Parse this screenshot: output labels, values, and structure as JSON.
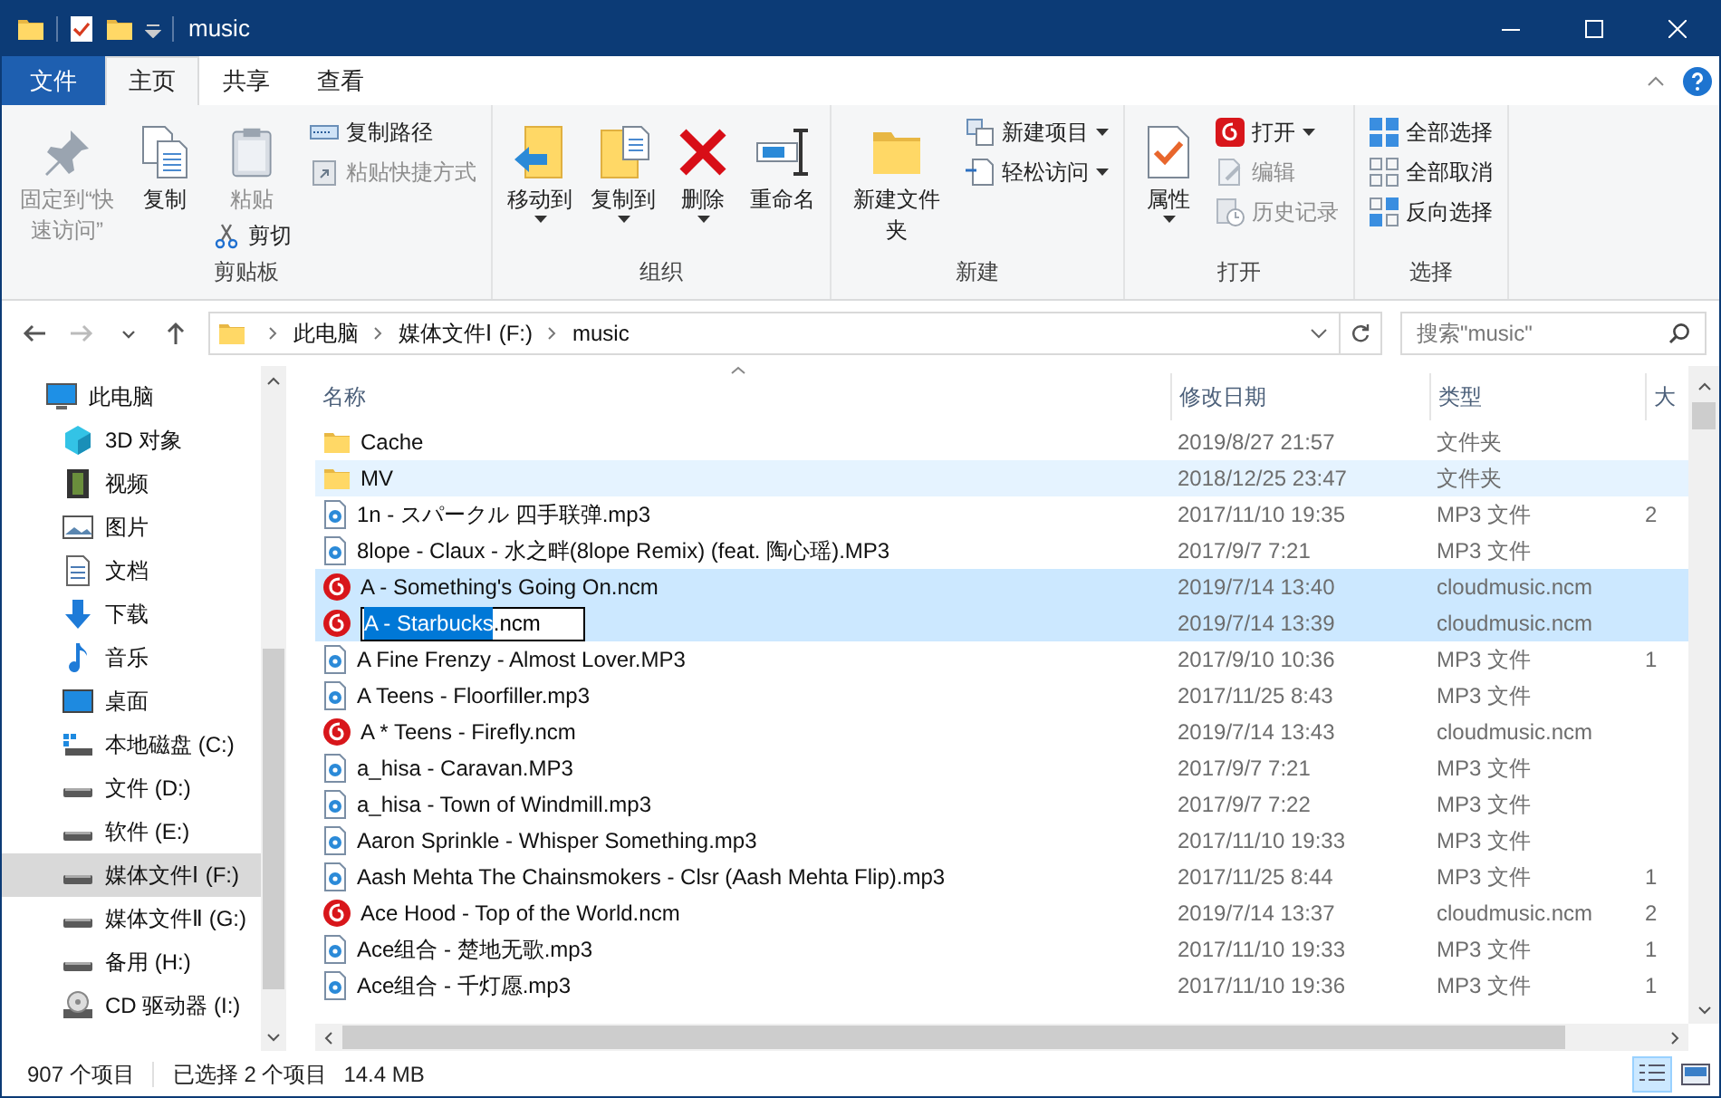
{
  "window": {
    "title": "music"
  },
  "ribbon_tabs": [
    {
      "label": "文件",
      "kind": "file",
      "selected": false
    },
    {
      "label": "主页",
      "kind": "tab",
      "selected": true
    },
    {
      "label": "共享",
      "kind": "tab",
      "selected": false
    },
    {
      "label": "查看",
      "kind": "tab",
      "selected": false
    }
  ],
  "ribbon_groups": [
    {
      "label": "剪贴板",
      "columns": [
        [
          {
            "label": "固定到“快速访问”",
            "kind": "large",
            "disabled": true,
            "dropdown": false
          }
        ],
        [
          {
            "label": "复制",
            "kind": "large",
            "disabled": false,
            "dropdown": false
          }
        ],
        [
          {
            "label": "粘贴",
            "kind": "medium",
            "disabled": true,
            "dropdown": false
          },
          {
            "label": "剪切",
            "kind": "small",
            "disabled": false,
            "dropdown": false
          }
        ],
        [
          {
            "label": "复制路径",
            "kind": "small",
            "disabled": false,
            "dropdown": false
          },
          {
            "label": "粘贴快捷方式",
            "kind": "small",
            "disabled": true,
            "dropdown": false
          }
        ]
      ]
    },
    {
      "label": "组织",
      "columns": [
        [
          {
            "label": "移动到",
            "kind": "large",
            "disabled": false,
            "dropdown": true
          }
        ],
        [
          {
            "label": "复制到",
            "kind": "large",
            "disabled": false,
            "dropdown": true
          }
        ],
        [
          {
            "label": "删除",
            "kind": "large",
            "disabled": false,
            "dropdown": true
          }
        ],
        [
          {
            "label": "重命名",
            "kind": "large",
            "disabled": false,
            "dropdown": false
          }
        ]
      ]
    },
    {
      "label": "新建",
      "columns": [
        [
          {
            "label": "新建文件夹",
            "kind": "large",
            "disabled": false,
            "dropdown": false
          }
        ],
        [
          {
            "label": "新建项目",
            "kind": "small",
            "disabled": false,
            "dropdown": true
          },
          {
            "label": "轻松访问",
            "kind": "small",
            "disabled": false,
            "dropdown": true
          }
        ]
      ]
    },
    {
      "label": "打开",
      "columns": [
        [
          {
            "label": "属性",
            "kind": "large",
            "disabled": false,
            "dropdown": true
          }
        ],
        [
          {
            "label": "打开",
            "kind": "small",
            "disabled": false,
            "dropdown": true
          },
          {
            "label": "编辑",
            "kind": "small",
            "disabled": true,
            "dropdown": false
          },
          {
            "label": "历史记录",
            "kind": "small",
            "disabled": true,
            "dropdown": false
          }
        ]
      ]
    },
    {
      "label": "选择",
      "columns": [
        [
          {
            "label": "全部选择",
            "kind": "small",
            "disabled": false,
            "dropdown": false
          },
          {
            "label": "全部取消",
            "kind": "small",
            "disabled": false,
            "dropdown": false
          },
          {
            "label": "反向选择",
            "kind": "small",
            "disabled": false,
            "dropdown": false
          }
        ]
      ]
    }
  ],
  "nav_buttons": [
    {
      "kind": "back",
      "disabled": false
    },
    {
      "kind": "forward",
      "disabled": true
    },
    {
      "kind": "recent",
      "disabled": false
    },
    {
      "kind": "up",
      "disabled": false
    }
  ],
  "breadcrumb": [
    "此电脑",
    "媒体文件Ⅰ (F:)",
    "music"
  ],
  "search": {
    "placeholder": "搜索\"music\""
  },
  "nav_pane": {
    "items": [
      {
        "label": "此电脑",
        "kind": "pc",
        "selected": false,
        "children": [
          {
            "label": "3D 对象",
            "kind": "cube",
            "selected": false
          },
          {
            "label": "视频",
            "kind": "film",
            "selected": false
          },
          {
            "label": "图片",
            "kind": "picture",
            "selected": false
          },
          {
            "label": "文档",
            "kind": "doc",
            "selected": false
          },
          {
            "label": "下载",
            "kind": "download",
            "selected": false
          },
          {
            "label": "音乐",
            "kind": "music",
            "selected": false
          },
          {
            "label": "桌面",
            "kind": "desktop",
            "selected": false
          },
          {
            "label": "本地磁盘 (C:)",
            "kind": "system-drive",
            "selected": false
          },
          {
            "label": "文件 (D:)",
            "kind": "drive",
            "selected": false
          },
          {
            "label": "软件 (E:)",
            "kind": "drive",
            "selected": false
          },
          {
            "label": "媒体文件Ⅰ (F:)",
            "kind": "drive",
            "selected": true
          },
          {
            "label": "媒体文件Ⅱ (G:)",
            "kind": "drive",
            "selected": false
          },
          {
            "label": "备用 (H:)",
            "kind": "drive",
            "selected": false
          },
          {
            "label": "CD 驱动器 (I:)",
            "kind": "cd",
            "selected": false
          }
        ]
      }
    ]
  },
  "file_list": {
    "columns": [
      "名称",
      "修改日期",
      "类型",
      "大"
    ],
    "rows": [
      {
        "name": "Cache",
        "kind": "folder",
        "date": "2019/8/27 21:57",
        "type": "文件夹",
        "selected": false,
        "hovered": false,
        "editing": false
      },
      {
        "name": "MV",
        "kind": "folder",
        "date": "2018/12/25 23:47",
        "type": "文件夹",
        "selected": false,
        "hovered": true,
        "editing": false
      },
      {
        "name": "1n - スパークル 四手联弹.mp3",
        "kind": "mp3",
        "date": "2017/11/10 19:35",
        "type": "MP3 文件",
        "column_4": "2",
        "selected": false,
        "hovered": false,
        "editing": false
      },
      {
        "name": "8lope - Claux - 水之畔(8lope Remix) (feat. 陶心瑶).MP3",
        "kind": "mp3",
        "date": "2017/9/7 7:21",
        "type": "MP3 文件",
        "selected": false,
        "hovered": false,
        "editing": false
      },
      {
        "name": "A - Something's Going On.ncm",
        "kind": "ncm",
        "date": "2019/7/14 13:40",
        "type": "cloudmusic.ncm",
        "selected": true,
        "hovered": false,
        "editing": false
      },
      {
        "name_selected": "A - Starbucks",
        "name_rest": ".ncm",
        "kind": "ncm",
        "date": "2019/7/14 13:39",
        "type": "cloudmusic.ncm",
        "selected": true,
        "hovered": false,
        "editing": true
      },
      {
        "name": "A Fine Frenzy - Almost Lover.MP3",
        "kind": "mp3",
        "date": "2017/9/10 10:36",
        "type": "MP3 文件",
        "column_4": "1",
        "selected": false,
        "hovered": false,
        "editing": false
      },
      {
        "name": "A Teens - Floorfiller.mp3",
        "kind": "mp3",
        "date": "2017/11/25 8:43",
        "type": "MP3 文件",
        "selected": false,
        "hovered": false,
        "editing": false
      },
      {
        "name": "A * Teens - Firefly.ncm",
        "kind": "ncm",
        "date": "2019/7/14 13:43",
        "type": "cloudmusic.ncm",
        "selected": false,
        "hovered": false,
        "editing": false
      },
      {
        "name": "a_hisa - Caravan.MP3",
        "kind": "mp3",
        "date": "2017/9/7 7:21",
        "type": "MP3 文件",
        "selected": false,
        "hovered": false,
        "editing": false
      },
      {
        "name": "a_hisa - Town of Windmill.mp3",
        "kind": "mp3",
        "date": "2017/9/7 7:22",
        "type": "MP3 文件",
        "selected": false,
        "hovered": false,
        "editing": false
      },
      {
        "name": "Aaron Sprinkle - Whisper Something.mp3",
        "kind": "mp3",
        "date": "2017/11/10 19:33",
        "type": "MP3 文件",
        "selected": false,
        "hovered": false,
        "editing": false
      },
      {
        "name": "Aash Mehta The Chainsmokers - Clsr (Aash Mehta Flip).mp3",
        "kind": "mp3",
        "date": "2017/11/25 8:44",
        "type": "MP3 文件",
        "column_4": "1",
        "selected": false,
        "hovered": false,
        "editing": false
      },
      {
        "name": "Ace Hood - Top of the World.ncm",
        "kind": "ncm",
        "date": "2019/7/14 13:37",
        "type": "cloudmusic.ncm",
        "column_4": "2",
        "selected": false,
        "hovered": false,
        "editing": false
      },
      {
        "name": "Ace组合 - 楚地无歌.mp3",
        "kind": "mp3",
        "date": "2017/11/10 19:33",
        "type": "MP3 文件",
        "column_4": "1",
        "selected": false,
        "hovered": false,
        "editing": false
      },
      {
        "name": "Ace组合 - 千灯愿.mp3",
        "kind": "mp3",
        "date": "2017/11/10 19:36",
        "type": "MP3 文件",
        "column_4": "1",
        "selected": false,
        "hovered": false,
        "editing": false
      }
    ]
  },
  "status_bar": {
    "item_count": "907 个项目",
    "selection": "已选择 2 个项目",
    "size": "14.4 MB"
  },
  "view_buttons": [
    {
      "kind": "details",
      "selected": true
    },
    {
      "kind": "large-icons",
      "selected": false
    }
  ]
}
